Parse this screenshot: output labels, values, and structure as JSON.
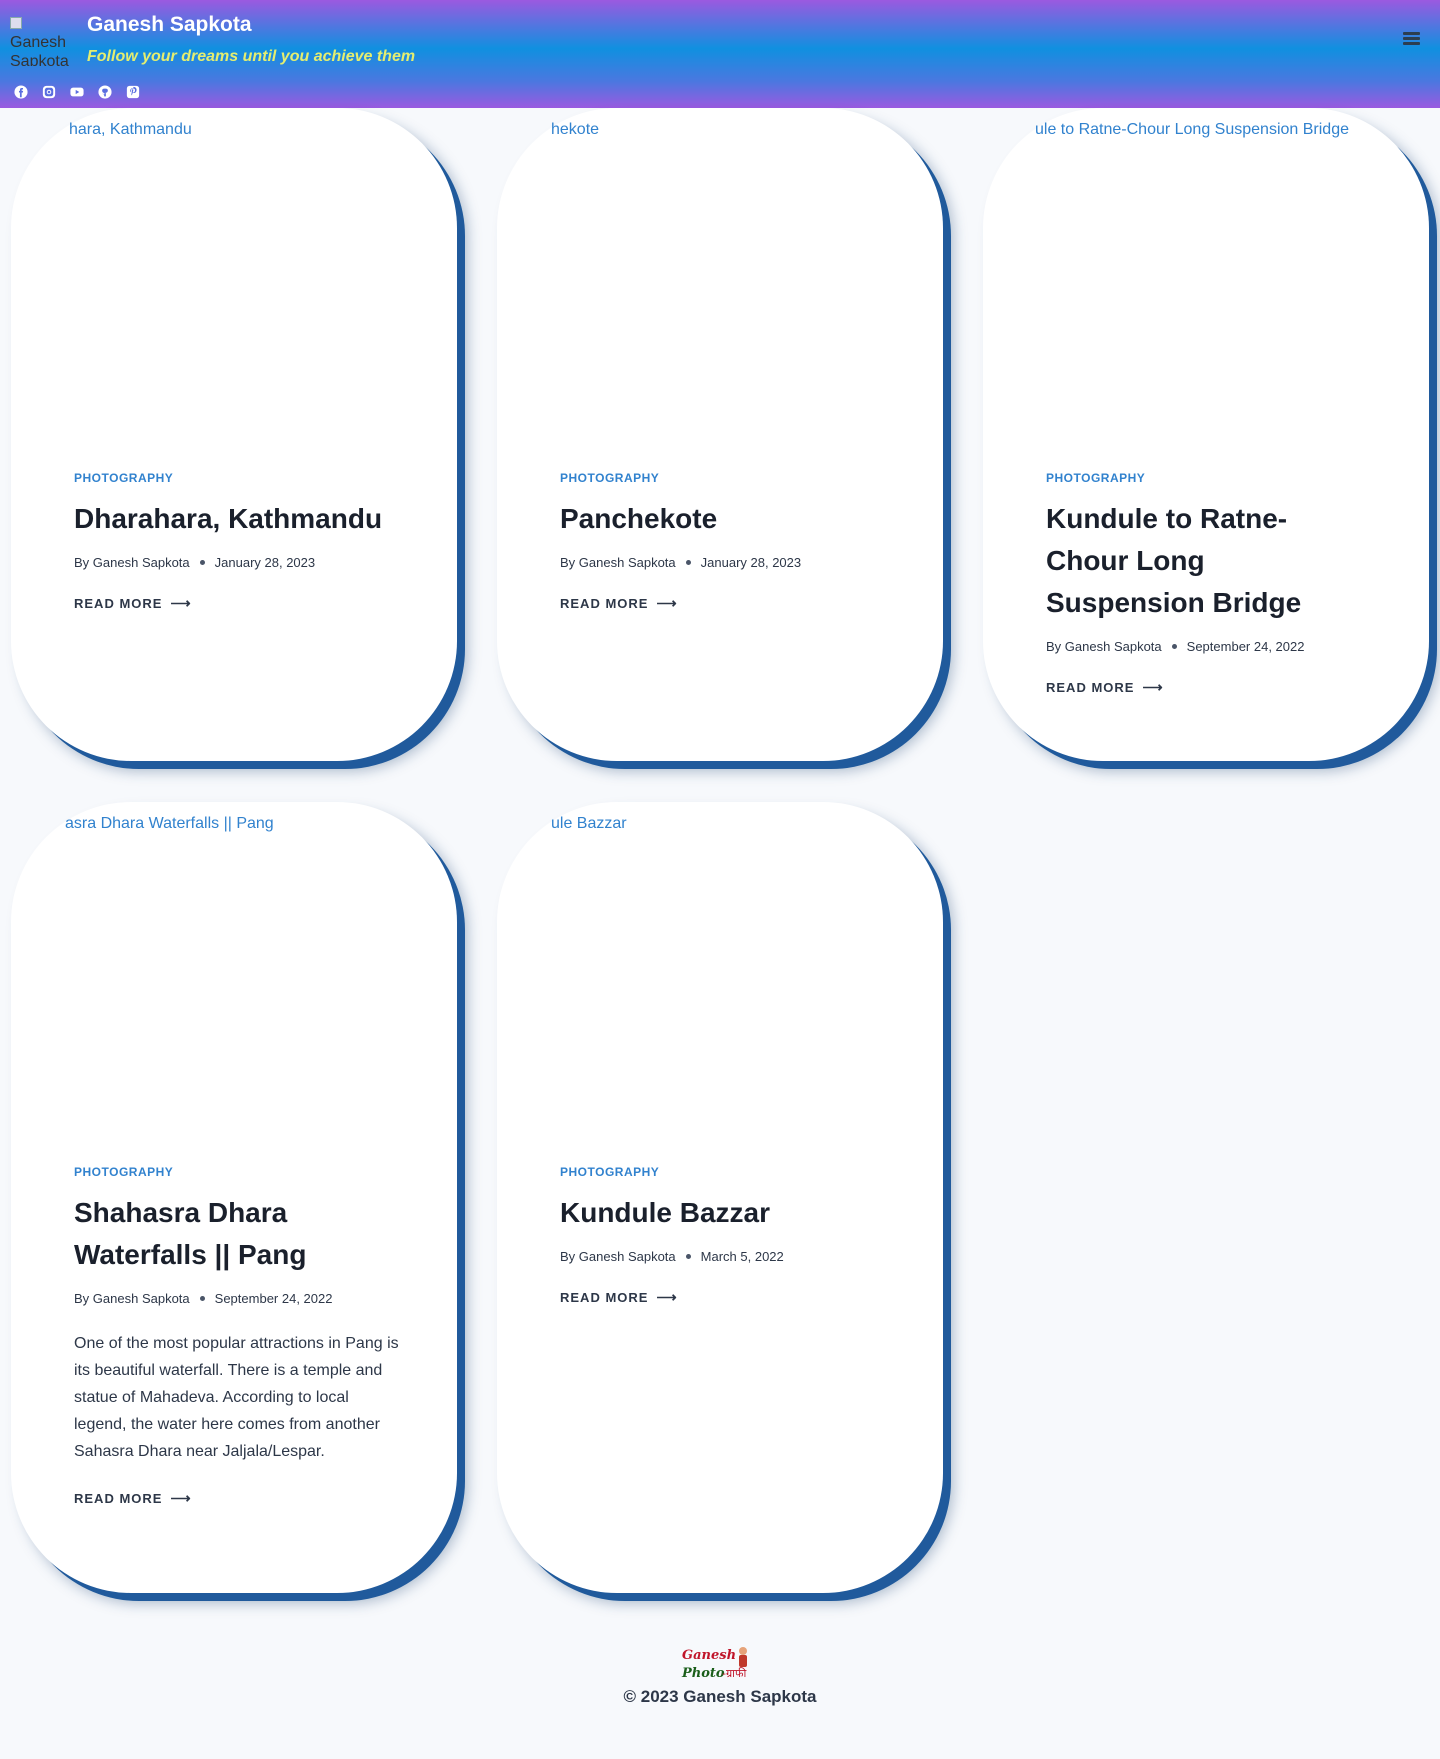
{
  "header": {
    "logo_alt": "Ganesh Sapkota",
    "site_title": "Ganesh Sapkota",
    "tagline": "Follow your dreams until you achieve them",
    "socials": [
      "facebook-icon",
      "instagram-icon",
      "youtube-icon",
      "github-icon",
      "pinterest-icon"
    ],
    "menu_icon": "hamburger-menu-icon"
  },
  "posts": [
    {
      "image_alt": "hara, Kathmandu",
      "category": "PHOTOGRAPHY",
      "title": "Dharahara, Kathmandu",
      "by": "By",
      "author": "Ganesh Sapkota",
      "date": "January 28, 2023",
      "read_more": "READ MORE"
    },
    {
      "image_alt": "hekote",
      "category": "PHOTOGRAPHY",
      "title": "Panchekote",
      "by": "By",
      "author": "Ganesh Sapkota",
      "date": "January 28, 2023",
      "read_more": "READ MORE"
    },
    {
      "image_alt": "ule to Ratne-Chour Long Suspension Bridge",
      "category": "PHOTOGRAPHY",
      "title": "Kundule to Ratne-Chour Long Suspension Bridge",
      "by": "By",
      "author": "Ganesh Sapkota",
      "date": "September 24, 2022",
      "read_more": "READ MORE"
    },
    {
      "image_alt": "asra Dhara Waterfalls || Pang",
      "category": "PHOTOGRAPHY",
      "title": "Shahasra Dhara Waterfalls || Pang",
      "by": "By",
      "author": "Ganesh Sapkota",
      "date": "September 24, 2022",
      "excerpt": "One of the most popular attractions in Pang is its beautiful waterfall. There is a temple and statue of Mahadeva. According to local legend, the water here comes from another Sahasra Dhara near Jaljala/Lespar.",
      "read_more": "READ MORE"
    },
    {
      "image_alt": "ule Bazzar",
      "category": "PHOTOGRAPHY",
      "title": "Kundule Bazzar",
      "by": "By",
      "author": "Ganesh Sapkota",
      "date": "March 5, 2022",
      "read_more": "READ MORE"
    }
  ],
  "footer": {
    "logo_text_1": "Ganesh",
    "logo_text_2": "Photo",
    "logo_text_3": "-ग्राफी",
    "copyright": "© 2023 Ganesh Sapkota"
  },
  "colors": {
    "accent": "#3182ce",
    "tagline": "#e4ee70",
    "card_shadow": "#205a9c"
  }
}
